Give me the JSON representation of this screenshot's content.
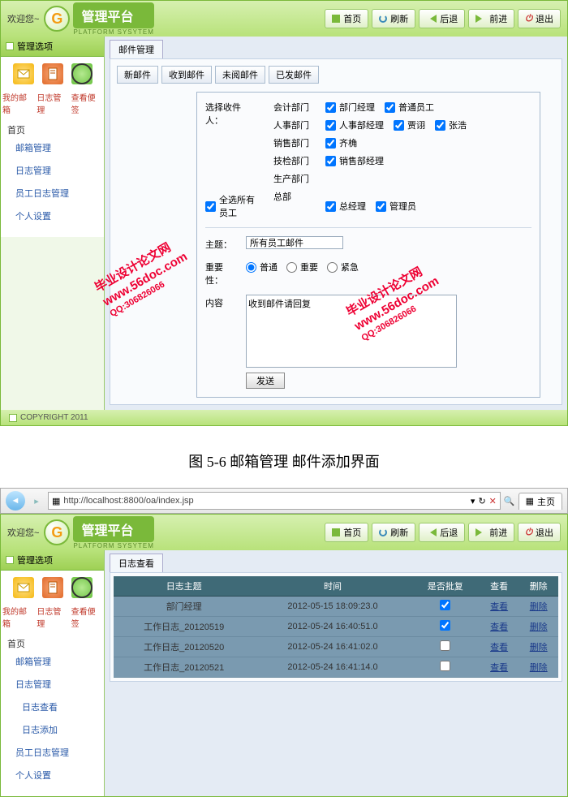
{
  "app1": {
    "welcome": "欢迎您~",
    "platform_title": "管理平台",
    "platform_sub": "PLATFORM SYSYTEM",
    "topnav": {
      "home": "首页",
      "refresh": "刷新",
      "back": "后退",
      "forward": "前进",
      "exit": "退出"
    },
    "side_header": "管理选项",
    "side_labels": {
      "mail": "我的邮箱",
      "log": "日志管理",
      "note": "查看便签"
    },
    "side_root": "首页",
    "side_items": [
      "邮箱管理",
      "日志管理",
      "员工日志管理",
      "个人设置"
    ],
    "content_title": "邮件管理",
    "mail_tabs": [
      "新邮件",
      "收到邮件",
      "未阅邮件",
      "已发邮件"
    ],
    "compose": {
      "select_recipient": "选择收件人：",
      "departments": [
        "会计部门",
        "人事部门",
        "销售部门",
        "技检部门",
        "生产部门",
        "总部"
      ],
      "select_all": "全选所有员工",
      "recipients_r1": [
        "部门经理",
        "普通员工"
      ],
      "recipients_r2": [
        "人事部经理",
        "贾诩",
        "张浩",
        "齐桷"
      ],
      "recipients_r3": [
        "销售部经理"
      ],
      "recipients_r4": [
        "总经理",
        "管理员"
      ],
      "subject_lbl": "主题：",
      "subject_val": "所有员工邮件",
      "priority_lbl": "重要性：",
      "priorities": [
        "普通",
        "重要",
        "紧急"
      ],
      "content_lbl": "内容",
      "content_val": "收到邮件请回复",
      "send": "发送"
    },
    "copyright": "COPYRIGHT 2011",
    "watermark_lines": [
      "毕业设计论文网",
      "www.56doc.com",
      "QQ:306826066"
    ]
  },
  "caption": "图 5-6     邮箱管理 邮件添加界面",
  "app2": {
    "url": "http://localhost:8800/oa/index.jsp",
    "tab_title": "主页",
    "side_root": "首页",
    "side_items": [
      "邮箱管理",
      "日志管理",
      "日志查看",
      "日志添加",
      "员工日志管理",
      "个人设置"
    ],
    "content_title": "日志查看",
    "table": {
      "headers": [
        "日志主题",
        "时间",
        "是否批复",
        "查看",
        "删除"
      ],
      "view": "查看",
      "delete": "删除",
      "rows": [
        {
          "subject": "部门经理",
          "time": "2012-05-15 18:09:23.0",
          "approved": true
        },
        {
          "subject": "工作日志_20120519",
          "time": "2012-05-24 16:40:51.0",
          "approved": true
        },
        {
          "subject": "工作日志_20120520",
          "time": "2012-05-24 16:41:02.0",
          "approved": false
        },
        {
          "subject": "工作日志_20120521",
          "time": "2012-05-24 16:41:14.0",
          "approved": false
        }
      ]
    }
  }
}
